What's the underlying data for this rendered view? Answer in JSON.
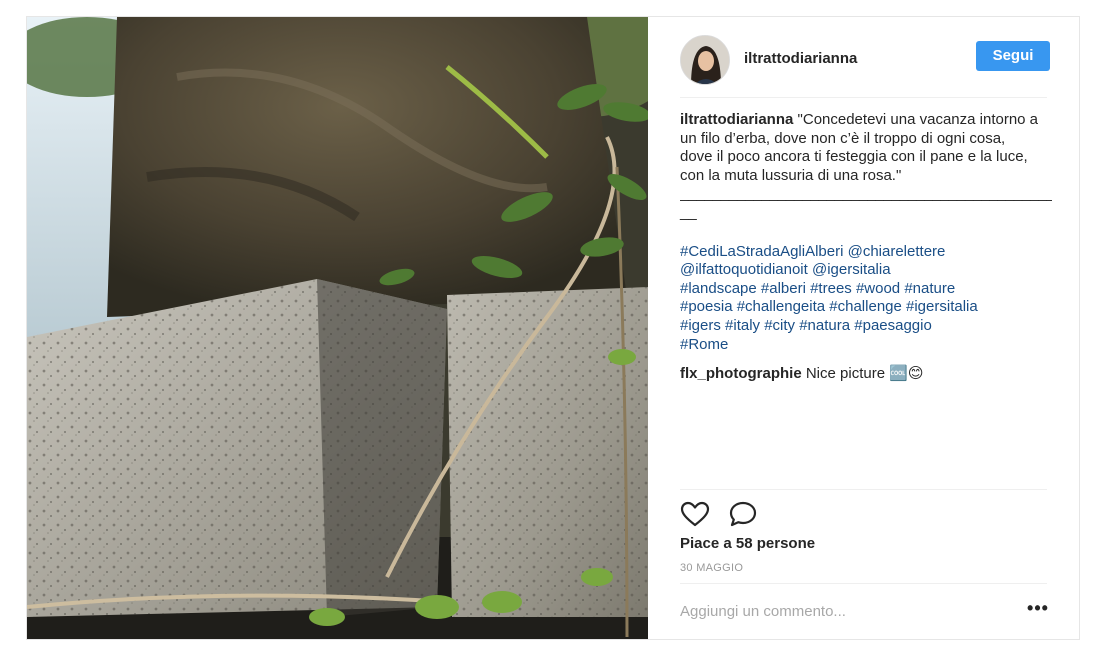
{
  "post": {
    "username": "iltrattodiarianna",
    "follow_label": "Segui",
    "caption": {
      "user": "iltrattodiarianna",
      "text": "\"Concedetevi una vacanza intorno a un filo d’erba, dove non c’è il troppo di ogni cosa,\ndove il poco ancora ti festeggia con il pane e la luce, con la muta lussuria di una rosa.\"",
      "rule": "_______________________________________________",
      "rule_tail": "__",
      "hashtag_lines": [
        "#CediLaStradaAgliAlberi @chiarelettere",
        "@ilfattoquotidianoit @igersitalia",
        "#landscape #alberi #trees #wood #nature",
        "#poesia #challengeita #challenge #igersitalia",
        "#igers #italy #city #natura #paesaggio",
        "#Rome"
      ]
    },
    "comments": [
      {
        "user": "flx_photographie",
        "text": "Nice picture",
        "emoji": "🆒😊"
      }
    ],
    "likes": "Piace a 58 persone",
    "date": "30 MAGGIO",
    "comment_placeholder": "Aggiungi un commento...",
    "more_label": "•••"
  },
  "icons": {
    "like": "heart-icon",
    "comment": "speech-bubble-icon",
    "more": "ellipsis-icon"
  },
  "colors": {
    "accent": "#3897f0",
    "link": "#1a4e86",
    "muted": "#999999",
    "border": "#efefef"
  }
}
